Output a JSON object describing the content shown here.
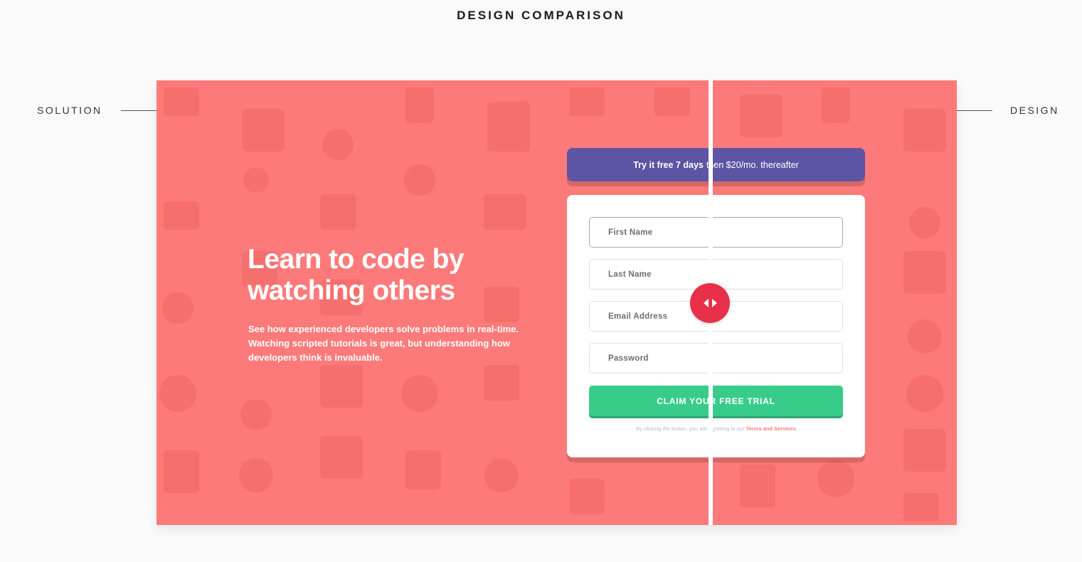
{
  "page": {
    "title": "DESIGN COMPARISON"
  },
  "labels": {
    "left": "SOLUTION",
    "right": "DESIGN"
  },
  "hero": {
    "title": "Learn to code by watching others",
    "text": "See how experienced developers solve problems in real-time. Watching scripted tutorials is great, but understanding how developers think is invaluable."
  },
  "promo": {
    "bold": "Try it free 7 days",
    "rest": "then $20/mo. thereafter"
  },
  "form": {
    "first_name_placeholder": "First Name",
    "last_name_placeholder": "Last Name",
    "email_placeholder": "Email Address",
    "password_placeholder": "Password",
    "submit_label": "CLAIM YOUR FREE TRIAL",
    "terms_text": "By clicking the button, you are agreeing to our",
    "terms_link": "Terms and Services"
  },
  "colors": {
    "background": "#fc7a79",
    "promo": "#5e54a4",
    "submit": "#38cc8b",
    "handle": "#e8304a"
  },
  "icons": [
    "double-arrow-icon"
  ]
}
